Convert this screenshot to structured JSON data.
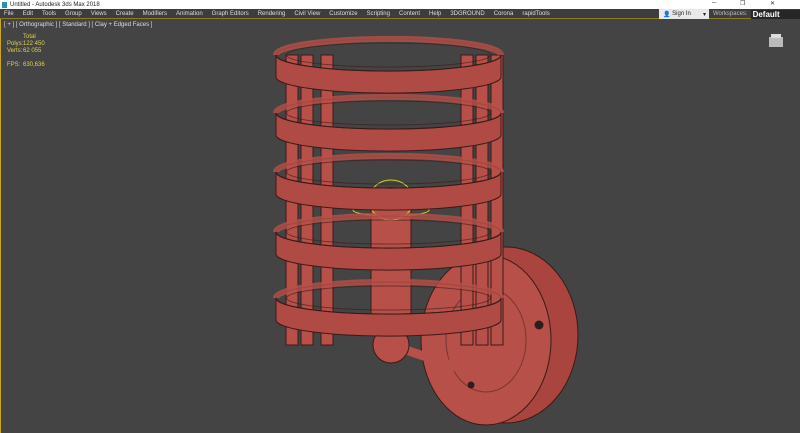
{
  "window": {
    "title": "Untitled - Autodesk 3ds Max 2018",
    "controls": [
      "─",
      "❐",
      "✕"
    ]
  },
  "menu": [
    "File",
    "Edit",
    "Tools",
    "Group",
    "Views",
    "Create",
    "Modifiers",
    "Animation",
    "Graph Editors",
    "Rendering",
    "Civil View",
    "Customize",
    "Scripting",
    "Content",
    "Help",
    "3DGROUND",
    "Corona",
    "rapidTools"
  ],
  "signin": {
    "label": "Sign In"
  },
  "workspaces": {
    "label": "Workspaces:",
    "value": "Default"
  },
  "viewport": {
    "label": "[ + ] [ Orthographic ] [ Standard ] [ Clay + Edged Faces ]",
    "stats": {
      "total": "Total",
      "polys_label": "Polys:",
      "polys": "122 450",
      "verts_label": "Verts:",
      "verts": "62 055",
      "fps_label": "FPS:",
      "fps": "630,636"
    }
  },
  "colors": {
    "mesh": "#b8504a",
    "accent": "#c9a814",
    "bg": "#444444"
  }
}
